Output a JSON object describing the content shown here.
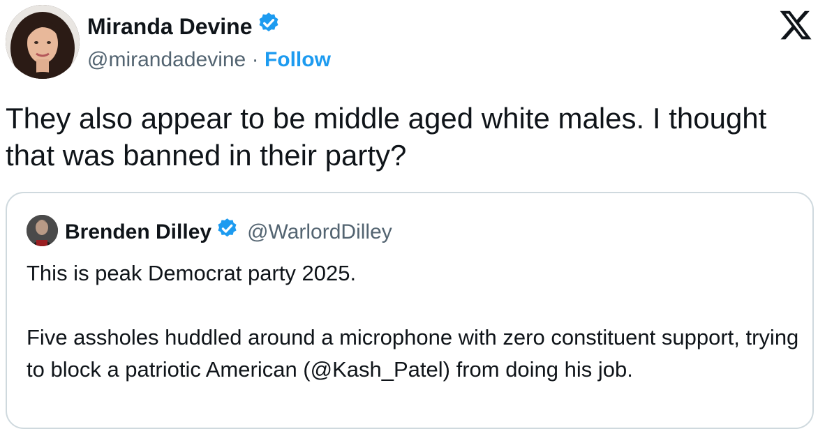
{
  "tweet": {
    "author_name": "Miranda Devine",
    "author_handle": "@mirandadevine",
    "separator": "·",
    "follow_label": "Follow",
    "text": "They also appear to be middle aged white males. I thought that was banned in their party?"
  },
  "quoted_tweet": {
    "author_name": "Brenden Dilley",
    "author_handle": "@WarlordDilley",
    "paragraphs": [
      "This is peak Democrat party 2025.",
      "Five assholes huddled around a microphone with zero constituent support, trying to block a patriotic American (@Kash_Patel) from doing his job."
    ]
  },
  "icons": {
    "verified": "verified-badge-icon",
    "platform": "x-logo-icon"
  },
  "colors": {
    "accent": "#1d9bf0",
    "text": "#0f1419",
    "muted": "#536471",
    "border": "#cfd9de"
  }
}
